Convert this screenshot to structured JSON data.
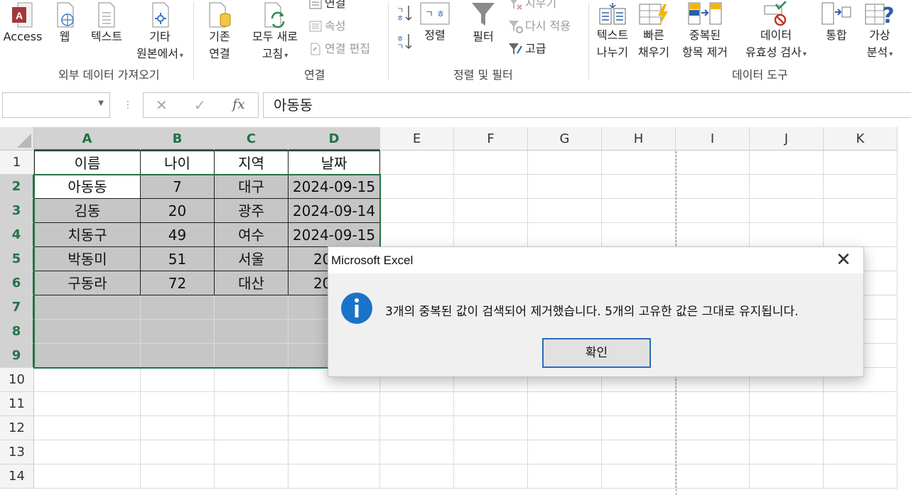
{
  "ribbon": {
    "get_external": {
      "access": "Access",
      "web": "웹",
      "text": "텍스트",
      "other_l1": "기타",
      "other_l2": "원본에서",
      "group": "외부 데이터 가져오기"
    },
    "connections": {
      "existing_l1": "기존",
      "existing_l2": "연결",
      "refresh_l1": "모두 새로",
      "refresh_l2": "고침",
      "connections": "연결",
      "properties": "속성",
      "edit_links": "연결 편집",
      "group": "연결"
    },
    "sort_filter": {
      "sort": "정렬",
      "filter": "필터",
      "clear": "지우기",
      "reapply": "다시 적용",
      "advanced": "고급",
      "group": "정렬 및 필터"
    },
    "data_tools": {
      "text_to_columns_l1": "텍스트",
      "text_to_columns_l2": "나누기",
      "flash_fill_l1": "빠른",
      "flash_fill_l2": "채우기",
      "remove_dup_l1": "중복된",
      "remove_dup_l2": "항목 제거",
      "validation_l1": "데이터",
      "validation_l2": "유효성 검사",
      "consolidate": "통합",
      "what_if_l1": "가상",
      "what_if_l2": "분석",
      "group": "데이터 도구"
    }
  },
  "formula_bar": {
    "name_box": "",
    "value": "아동동"
  },
  "columns": [
    "A",
    "B",
    "C",
    "D",
    "E",
    "F",
    "G",
    "H",
    "I",
    "J",
    "K"
  ],
  "rows": [
    "1",
    "2",
    "3",
    "4",
    "5",
    "6",
    "7",
    "8",
    "9",
    "10",
    "11",
    "12",
    "13",
    "14"
  ],
  "table": {
    "header": [
      "이름",
      "나이",
      "지역",
      "날짜"
    ],
    "rows": [
      [
        "아동동",
        "7",
        "대구",
        "2024-09-15"
      ],
      [
        "김동",
        "20",
        "광주",
        "2024-09-14"
      ],
      [
        "치동구",
        "49",
        "여수",
        "2024-09-15"
      ],
      [
        "박동미",
        "51",
        "서울",
        "2024-"
      ],
      [
        "구동라",
        "72",
        "대산",
        "2024-"
      ]
    ]
  },
  "dialog": {
    "title": "Microsoft Excel",
    "message": "3개의 중복된 값이 검색되어 제거했습니다. 5개의 고유한 값은 그대로 유지됩니다.",
    "ok": "확인"
  },
  "colors": {
    "excel_green": "#217346",
    "selection_fill": "#c6c6c6",
    "info_blue": "#1a73c8"
  }
}
